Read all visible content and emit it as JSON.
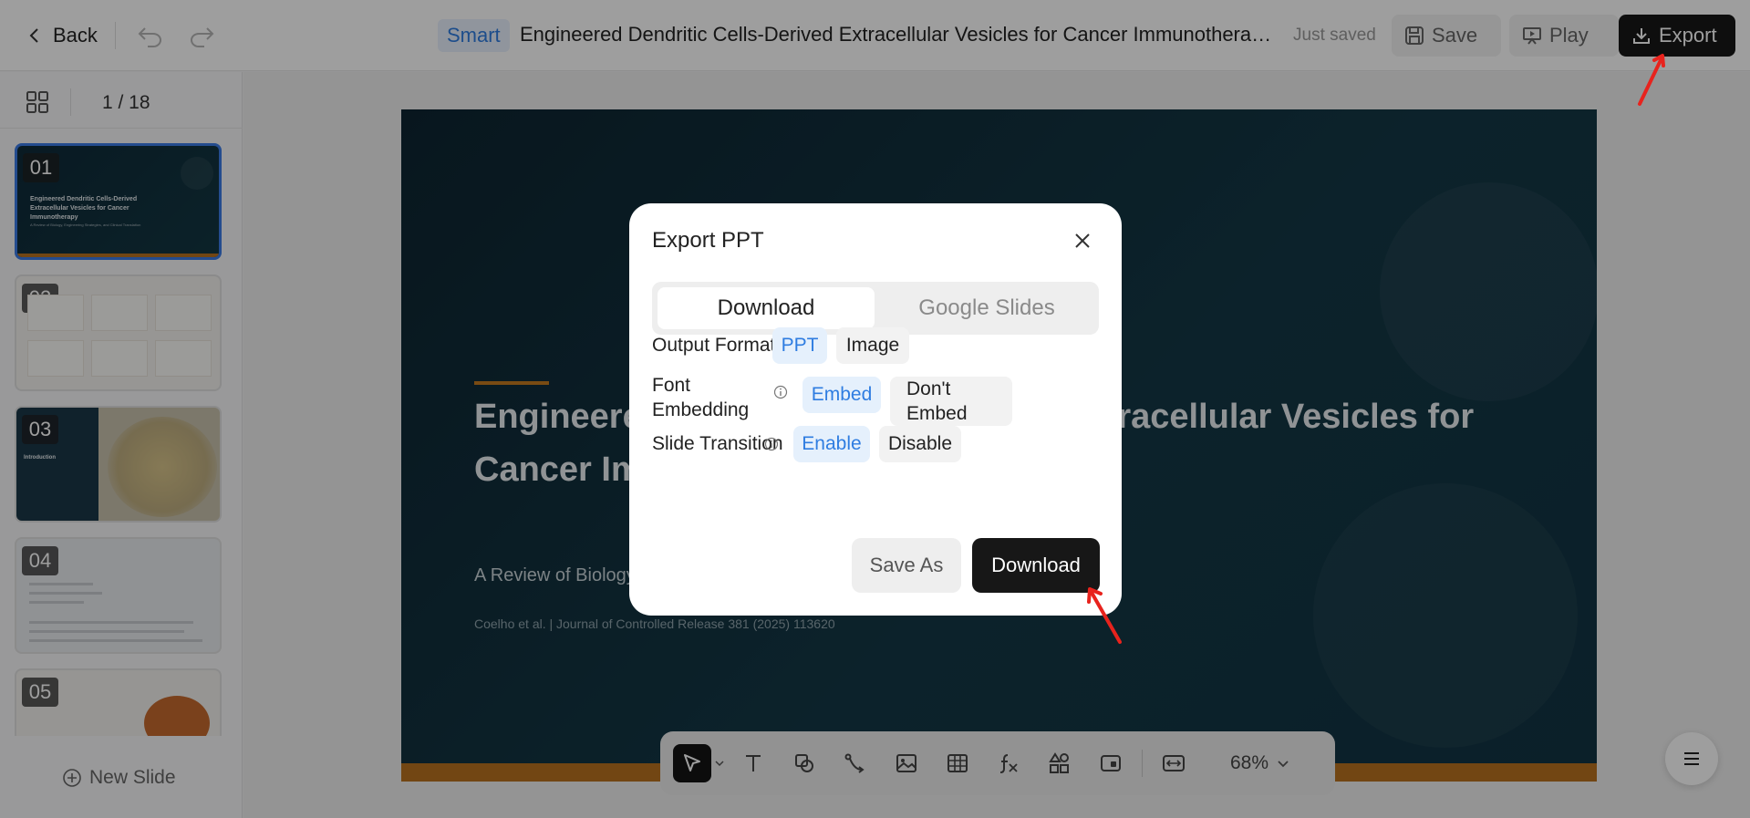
{
  "topbar": {
    "back_label": "Back",
    "badge": "Smart",
    "doc_title": "Engineered Dendritic Cells-Derived Extracellular Vesicles for Cancer Immunotherapy",
    "status": "Just saved",
    "save_label": "Save",
    "play_label": "Play",
    "export_label": "Export"
  },
  "sidebar": {
    "page_indicator": "1 / 18",
    "slides": [
      {
        "num": "01",
        "title": "Engineered Dendritic Cells-Derived Extracellular Vesicles for Cancer Immunotherapy",
        "subtitle": "A Review of Biology, Engineering Strategies, and Clinical Translation"
      },
      {
        "num": "02"
      },
      {
        "num": "03",
        "title": "Introduction"
      },
      {
        "num": "04"
      },
      {
        "num": "05"
      }
    ],
    "new_slide_label": "New Slide"
  },
  "slide": {
    "title": "Engineered Dendritic Cells-Derived Extracellular Vesicles for Cancer Immunotherapy",
    "subtitle": "A Review of Biology, Engineering Strategies, and Clinical Translation",
    "citation": "Coelho et al. | Journal of Controlled Release 381 (2025) 113620"
  },
  "toolbar": {
    "tools": [
      "select-icon",
      "text-icon",
      "shape-icon",
      "connector-icon",
      "image-icon",
      "table-icon",
      "formula-icon",
      "components-icon",
      "media-icon",
      "fit-icon"
    ],
    "zoom": "68%"
  },
  "modal": {
    "title": "Export PPT",
    "tabs": [
      "Download",
      "Google Slides"
    ],
    "active_tab": "Download",
    "output_format": {
      "label": "Output Format",
      "options": [
        "PPT",
        "Image"
      ],
      "selected": "PPT"
    },
    "font_embedding": {
      "label": "Font Embedding",
      "options": [
        "Embed",
        "Don't Embed"
      ],
      "selected": "Embed"
    },
    "slide_transition": {
      "label": "Slide Transition",
      "options": [
        "Enable",
        "Disable"
      ],
      "selected": "Enable"
    },
    "save_as_label": "Save As",
    "download_label": "Download"
  },
  "colors": {
    "accent_blue": "#2f7de1",
    "dark_button": "#171717",
    "slide_bg": "#123443",
    "slide_accent": "#b8721f",
    "arrow": "#e8231d"
  }
}
